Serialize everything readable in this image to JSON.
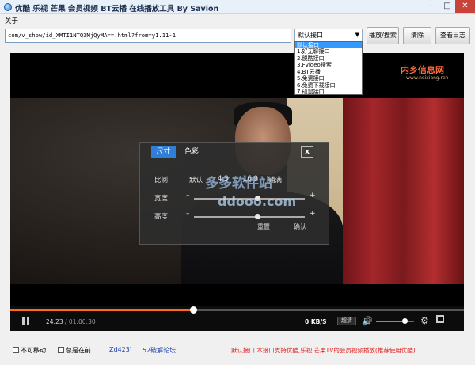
{
  "window": {
    "title": "优酷 乐视 芒果 会员视频 BT云播 在线播放工具 By Savion",
    "min_label": "–",
    "max_label": "□",
    "close_label": "✕"
  },
  "menu": {
    "about": "关于"
  },
  "toolbar": {
    "url_value": "com/v_show/id_XMTI1NTQ3MjQyMA==.html?from=y1.11-1",
    "combo_value": "默认接口",
    "play_search_label": "播放/搜索",
    "clear_label": "清除",
    "view_log_label": "查看日志"
  },
  "dropdown": {
    "items": [
      "默认接口",
      "1.好无聊接口",
      "2.脱酷接口",
      "3.Fvideo搜索",
      "4.BT云播",
      "5.免费接口",
      "6.免费下载接口",
      "7.硕鼠接口"
    ],
    "selected_index": 0
  },
  "video": {
    "logo_text": "内乡信息网",
    "logo_sub": "www.neixiang.ren",
    "watermark": "多多软件站",
    "watermark2": "ddooo.com"
  },
  "adjust_dialog": {
    "tab_size": "尺寸",
    "tab_color": "色彩",
    "close": "x",
    "ratio_label": "比例:",
    "ratio_options": [
      "默认",
      "4:3",
      "16:9",
      "铺满"
    ],
    "width_label": "宽度:",
    "height_label": "高度:",
    "minus": "–",
    "plus": "+",
    "width_level": 0.55,
    "height_level": 0.55,
    "reset_label": "重置",
    "confirm_label": "确认"
  },
  "controls": {
    "progress": 0.403,
    "current_time": "24:23",
    "duration": "/ 01:00:30",
    "speed": "0 KB/S",
    "quality": "超清",
    "volume_level": 0.75
  },
  "statusbar": {
    "no_move": "不可移动",
    "always_top": "总是在前",
    "id_text": "Zd423'",
    "forum": "52破解论坛",
    "notice": "默认接口 本接口支持优酷,乐视,芒果TV的会员视频播放(推荐使用优酷)"
  },
  "colors": {
    "accent": "#ff6a1a",
    "tab_active": "#2f7fd8",
    "notice": "#e02020",
    "link": "#1a3fb0"
  }
}
